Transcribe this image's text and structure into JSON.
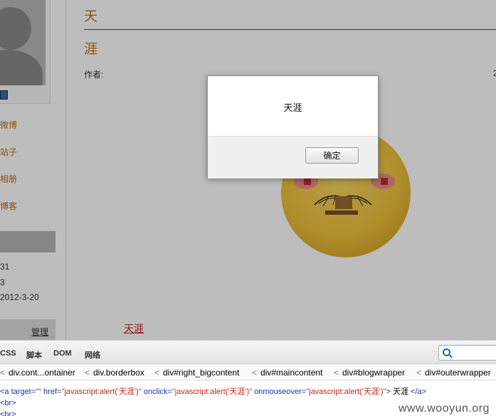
{
  "blog": {
    "title_line1": "天",
    "title_line2": "涯",
    "author_label": "作者:",
    "date_fragment": "2",
    "post_link": "天涯"
  },
  "sidebar": {
    "links": [
      "微博",
      "站子",
      "相册",
      "博客"
    ],
    "stats": [
      "31",
      "3",
      "2012-3-20"
    ],
    "manage": "管理"
  },
  "dialog": {
    "message": "天涯",
    "ok_label": "确定"
  },
  "devtools": {
    "tabs": [
      "CSS",
      "脚本",
      "DOM",
      "网络"
    ],
    "search_value": "",
    "breadcrumb": [
      "div.cont...ontainer",
      "div.borderbox",
      "div#right_bigcontent",
      "div#maincontent",
      "div#blogwrapper",
      "div#outerwrapper"
    ],
    "breadcrumb_sep": "<",
    "code": {
      "tag_open": "<a",
      "attr_target": "target=",
      "val_target": "\"\"",
      "attr_href": "href=",
      "val_href": "\"javascript:alert('天涯')\"",
      "attr_onclick": "onclick=",
      "val_onclick": "\"javascript:alert('天涯')\"",
      "attr_onmouseover": "onmouseover=",
      "val_onmouseover": "\"javascript:alert('天涯')\"",
      "tag_close": ">",
      "text": " 天涯 ",
      "end_tag": "</a>",
      "br1": "<br>",
      "br2": "<br>"
    }
  },
  "watermark": "www.wooyun.org",
  "colors": {
    "accent": "#c46b1d",
    "link_red": "#d31e1e",
    "attr_blue": "#1b2fb0",
    "value_red": "#c3271b"
  }
}
